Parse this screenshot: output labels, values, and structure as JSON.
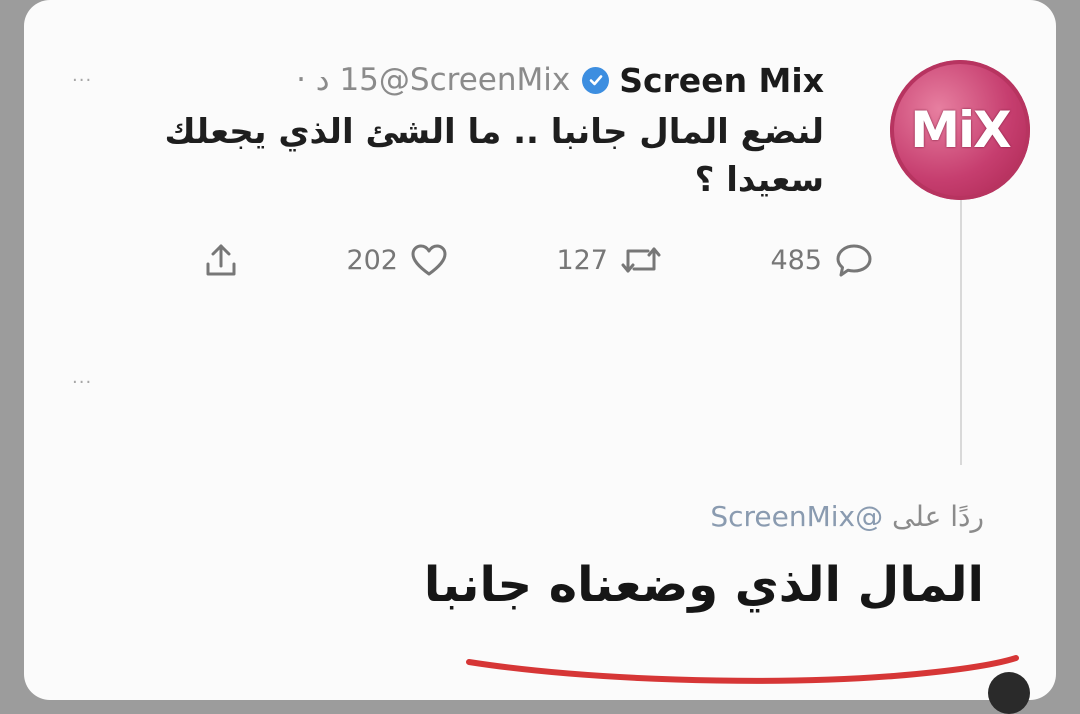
{
  "tweet": {
    "display_name": "Screen Mix",
    "handle": "@ScreenMix",
    "meta": "15 د ·",
    "text": "لنضع المال جانبا .. ما الشئ الذي يجعلك سعيدا ؟",
    "avatar_text": "MiX",
    "more_icon": "···",
    "counts": {
      "replies": "485",
      "retweets": "127",
      "likes": "202"
    }
  },
  "reply": {
    "more_icon": "···",
    "replying_label": "ردًا على",
    "replying_handle": "@ScreenMix",
    "text": "المال الذي وضعناه جانبا"
  },
  "colors": {
    "verified": "#3d8ee0",
    "avatar": "#c63e6f",
    "underline": "#d63636"
  }
}
